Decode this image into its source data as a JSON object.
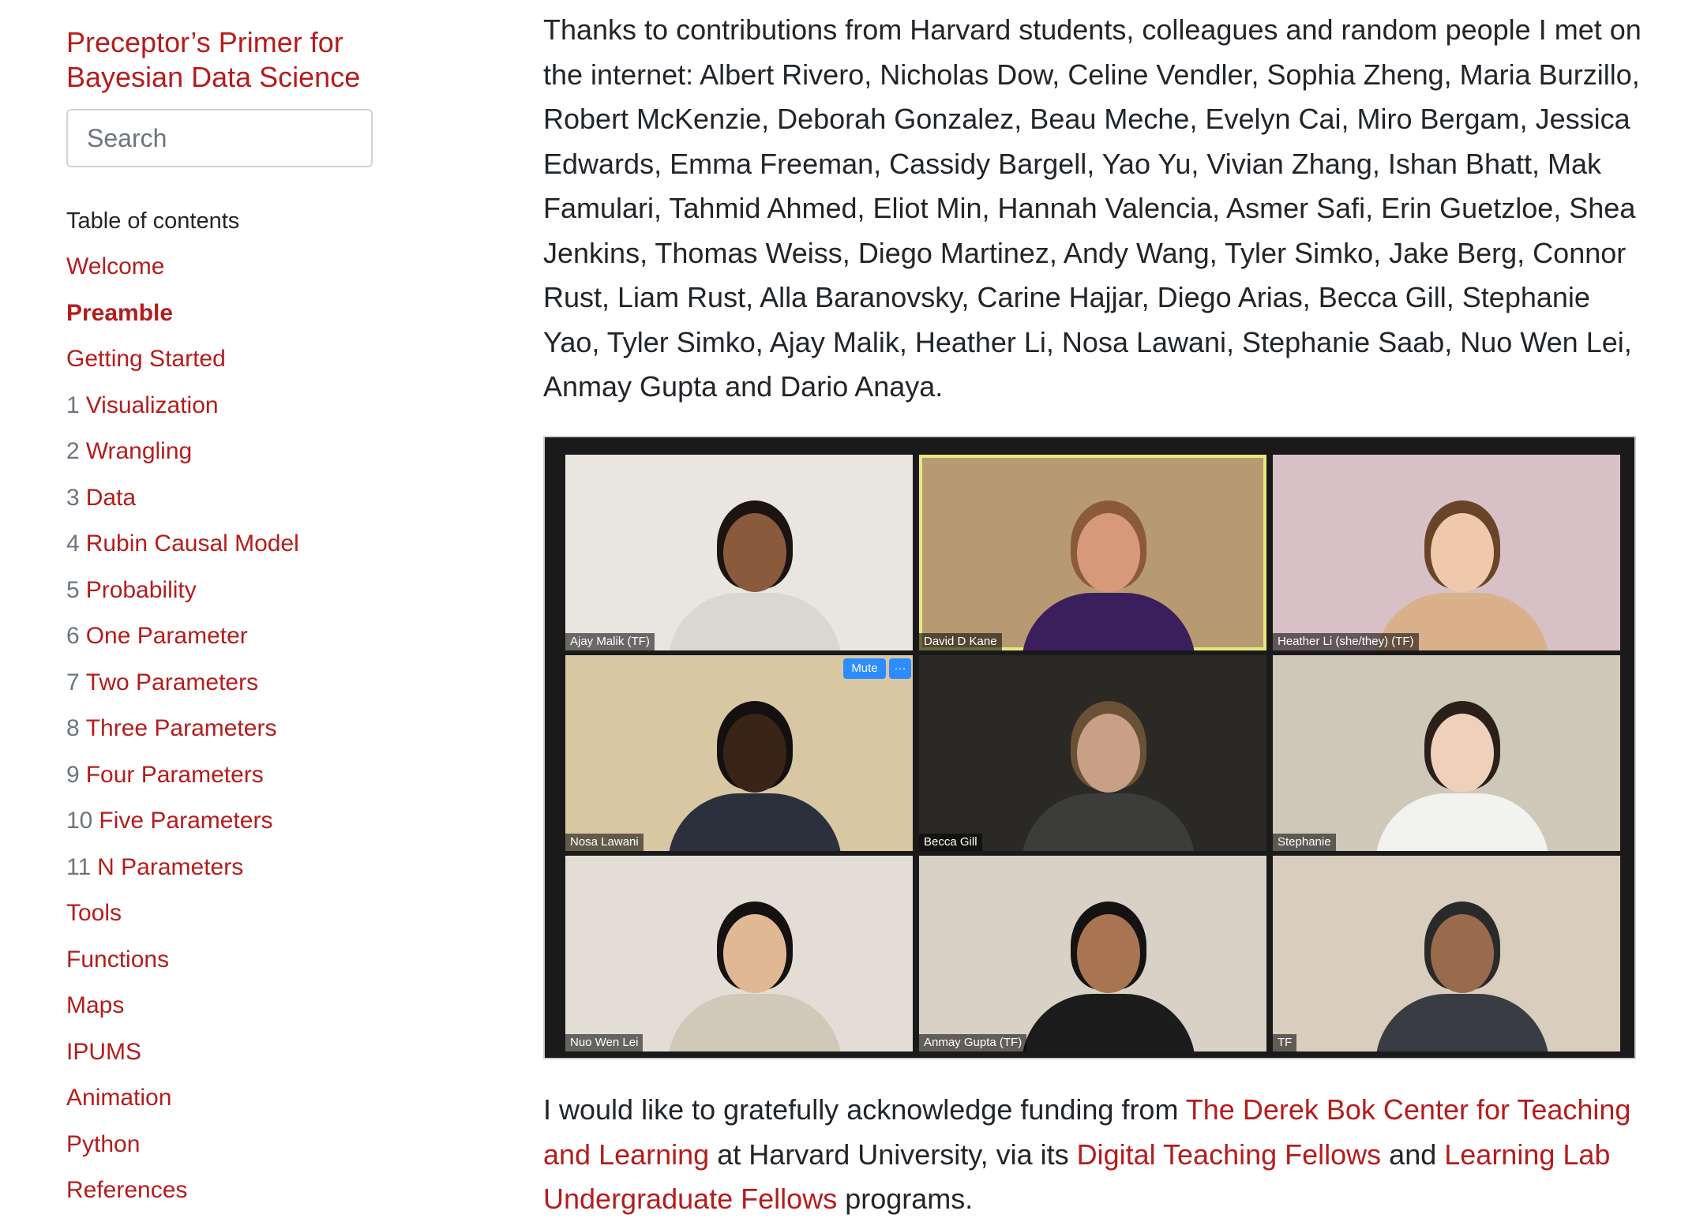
{
  "sidebar": {
    "title": "Preceptor’s Primer for Bayesian Data Science",
    "search_placeholder": "Search",
    "toc_label": "Table of contents",
    "items": [
      {
        "num": "",
        "label": "Welcome"
      },
      {
        "num": "",
        "label": "Preamble"
      },
      {
        "num": "",
        "label": "Getting Started"
      },
      {
        "num": "1",
        "label": "Visualization"
      },
      {
        "num": "2",
        "label": "Wrangling"
      },
      {
        "num": "3",
        "label": "Data"
      },
      {
        "num": "4",
        "label": "Rubin Causal Model"
      },
      {
        "num": "5",
        "label": "Probability"
      },
      {
        "num": "6",
        "label": "One Parameter"
      },
      {
        "num": "7",
        "label": "Two Parameters"
      },
      {
        "num": "8",
        "label": "Three Parameters"
      },
      {
        "num": "9",
        "label": "Four Parameters"
      },
      {
        "num": "10",
        "label": "Five Parameters"
      },
      {
        "num": "11",
        "label": "N Parameters"
      },
      {
        "num": "",
        "label": "Tools"
      },
      {
        "num": "",
        "label": "Functions"
      },
      {
        "num": "",
        "label": "Maps"
      },
      {
        "num": "",
        "label": "IPUMS"
      },
      {
        "num": "",
        "label": "Animation"
      },
      {
        "num": "",
        "label": "Python"
      },
      {
        "num": "",
        "label": "References"
      }
    ]
  },
  "main": {
    "thanks_paragraph": "Thanks to contributions from Harvard students, colleagues and random people I met on the internet: Albert Rivero, Nicholas Dow, Celine Vendler, Sophia Zheng, Maria Burzillo, Robert McKenzie, Deborah Gonzalez, Beau Meche, Evelyn Cai, Miro Bergam, Jessica Edwards, Emma Freeman, Cassidy Bargell, Yao Yu, Vivian Zhang, Ishan Bhatt, Mak Famulari, Tahmid Ahmed, Eliot Min, Hannah Valencia, Asmer Safi, Erin Guetzloe, Shea Jenkins, Thomas Weiss, Diego Martinez, Andy Wang, Tyler Simko, Jake Berg, Connor Rust, Liam Rust, Alla Baranovsky, Carine Hajjar, Diego Arias, Becca Gill, Stephanie Yao, Tyler Simko, Ajay Malik, Heather Li, Nosa Lawani, Stephanie Saab, Nuo Wen Lei, Anmay Gupta and Dario Anaya.",
    "funding": {
      "text_1": "I would like to gratefully acknowledge funding from ",
      "link_1": "The Derek Bok Center for Teaching and Learning",
      "text_2": " at Harvard University, via its ",
      "link_2": "Digital Teaching Fellows",
      "text_3": " and ",
      "link_3": "Learning Lab Undergraduate Fellows",
      "text_4": " programs."
    },
    "zoom_controls": {
      "mute": "Mute",
      "more": "···"
    },
    "zoom_tiles": [
      {
        "name": "Ajay Malik (TF)",
        "bg": "#e9e6e2",
        "skin": "#8a5a3c",
        "shirt": "#d8d8d0",
        "hair": "#1b1411"
      },
      {
        "name": "David D Kane",
        "bg": "#b89a72",
        "skin": "#d8997a",
        "shirt": "#3b1e5c",
        "hair": "#8a5a3a"
      },
      {
        "name": "Heather Li (she/they) (TF)",
        "bg": "#d7c1c7",
        "skin": "#f0c9ad",
        "shirt": "#d9b08a",
        "hair": "#6a4428"
      },
      {
        "name": "Nosa Lawani",
        "bg": "#d8c7a3",
        "skin": "#3a2418",
        "shirt": "#2c2f3c",
        "hair": "#141010"
      },
      {
        "name": "Becca Gill",
        "bg": "#2a2926",
        "skin": "#c7a085",
        "shirt": "#3c3c3a",
        "hair": "#6a5035"
      },
      {
        "name": "Stephanie",
        "bg": "#cfc7b8",
        "skin": "#efd0bb",
        "shirt": "#f2f2ee",
        "hair": "#2a2019"
      },
      {
        "name": "Nuo Wen Lei",
        "bg": "#e2ded6",
        "skin": "#e0b894",
        "shirt": "#d0c8b8",
        "hair": "#151110"
      },
      {
        "name": "Anmay Gupta (TF)",
        "bg": "#d7d1c6",
        "skin": "#a87452",
        "shirt": "#1c1c1c",
        "hair": "#151212"
      },
      {
        "name": "TF",
        "bg": "#d9cdbd",
        "skin": "#9a6a4c",
        "shirt": "#3a3c44",
        "hair": "#2a2a2a"
      }
    ]
  }
}
